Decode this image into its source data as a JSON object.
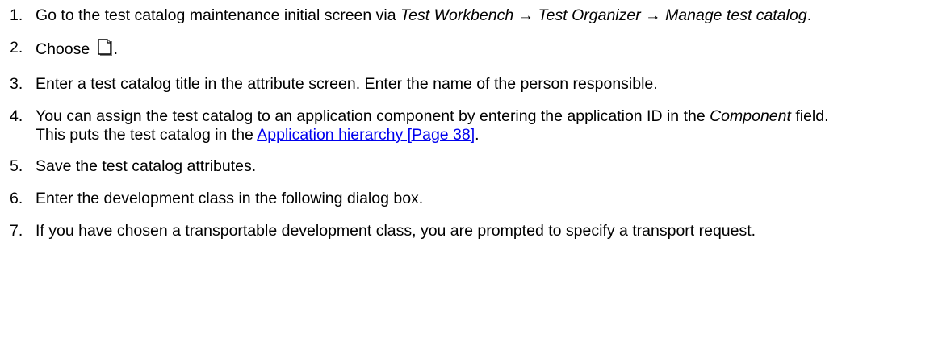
{
  "steps": [
    {
      "num": "1.",
      "t1": "Go to the test catalog maintenance initial screen via ",
      "nav1": "Test Workbench",
      "arrow1": " → ",
      "nav2": "Test Organizer",
      "arrow2": " → ",
      "nav3": "Manage test catalog",
      "t2": "."
    },
    {
      "num": "2.",
      "t1": "Choose ",
      "icon": "new-document-icon",
      "t2": "."
    },
    {
      "num": "3.",
      "t1": "Enter a test catalog title in the attribute screen. Enter the name of the person responsible."
    },
    {
      "num": "4.",
      "t1": "You can assign the test catalog to an application component by entering the application ID in the ",
      "em": "Component",
      "t2": " field.",
      "t3": "This puts the test catalog in the ",
      "link": "Application hierarchy [Page 38]",
      "t4": "."
    },
    {
      "num": "5.",
      "t1": "Save the test catalog attributes."
    },
    {
      "num": "6.",
      "t1": "Enter the development class in the following dialog box."
    },
    {
      "num": "7.",
      "t1": "If you have chosen a transportable development class, you are prompted to specify a transport request."
    }
  ],
  "colors": {
    "text": "#000000",
    "link": "#0000ee"
  }
}
